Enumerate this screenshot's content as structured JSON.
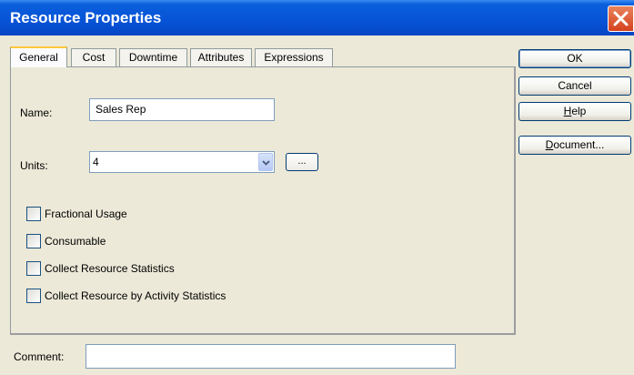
{
  "window": {
    "title": "Resource Properties"
  },
  "tabs": [
    {
      "label": "General",
      "active": true
    },
    {
      "label": "Cost"
    },
    {
      "label": "Downtime"
    },
    {
      "label": "Attributes"
    },
    {
      "label": "Expressions"
    }
  ],
  "general": {
    "name_label": "Name:",
    "name_value": "Sales Rep",
    "units_label": "Units:",
    "units_value": "4",
    "ellipsis_label": "...",
    "checkboxes": [
      {
        "label": "Fractional Usage",
        "checked": false
      },
      {
        "label": "Consumable",
        "checked": false
      },
      {
        "label": "Collect Resource Statistics",
        "checked": false
      },
      {
        "label": "Collect Resource by Activity Statistics",
        "checked": false
      }
    ]
  },
  "buttons": {
    "ok": "OK",
    "cancel": "Cancel",
    "help_prefix": "",
    "help_mnemonic": "H",
    "help_rest": "elp",
    "document_mnemonic": "D",
    "document_rest": "ocument..."
  },
  "comment": {
    "label": "Comment:",
    "value": ""
  },
  "icons": {
    "close": "close-icon",
    "dropdown": "chevron-down-icon"
  },
  "colors": {
    "titlebar": "#0753d6",
    "close_button": "#d5411f",
    "active_tab_accent": "#ffc83c",
    "dialog_bg": "#ece9d8"
  }
}
